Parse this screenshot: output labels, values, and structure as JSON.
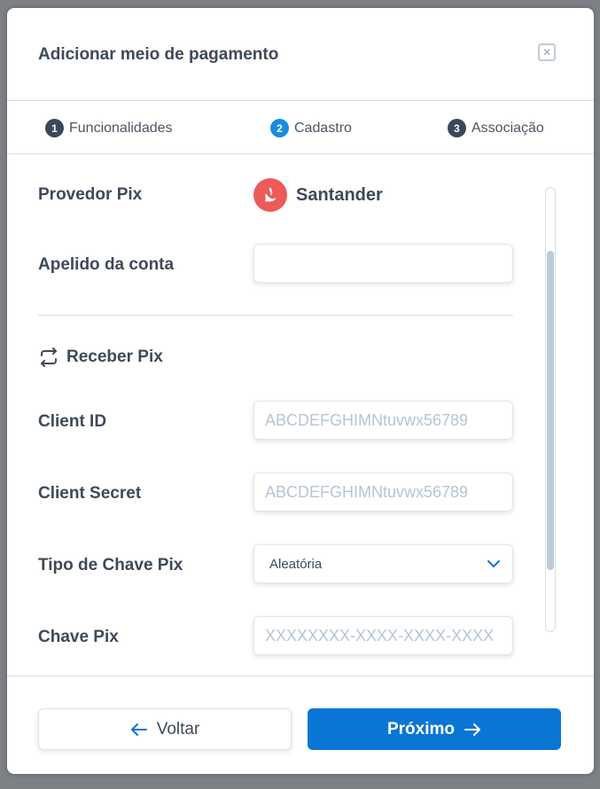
{
  "modal": {
    "title": "Adicionar meio de pagamento",
    "close_icon": "close-icon"
  },
  "steps": [
    {
      "number": "1",
      "label": "Funcionalidades",
      "active": false
    },
    {
      "number": "2",
      "label": "Cadastro",
      "active": true
    },
    {
      "number": "3",
      "label": "Associação",
      "active": false
    }
  ],
  "form": {
    "provider_label": "Provedor Pix",
    "provider_name": "Santander",
    "provider_icon": "santander-logo-icon",
    "nickname_label": "Apelido da conta",
    "nickname_value": "",
    "receive_section": "Receber Pix",
    "receive_icon": "transfer-arrows-icon",
    "client_id_label": "Client ID",
    "client_id_placeholder": "ABCDEFGHIMNtuvwx56789",
    "client_secret_label": "Client Secret",
    "client_secret_placeholder": "ABCDEFGHIMNtuvwx56789",
    "key_type_label": "Tipo de Chave Pix",
    "key_type_value": "Aleatória",
    "key_label": "Chave Pix",
    "key_placeholder": "XXXXXXXX-XXXX-XXXX-XXXX"
  },
  "footer": {
    "back_label": "Voltar",
    "next_label": "Próximo"
  },
  "colors": {
    "primary": "#0a76d4",
    "active_step": "#1a8be0",
    "santander": "#ec5a5a",
    "text": "#3d4a59"
  }
}
